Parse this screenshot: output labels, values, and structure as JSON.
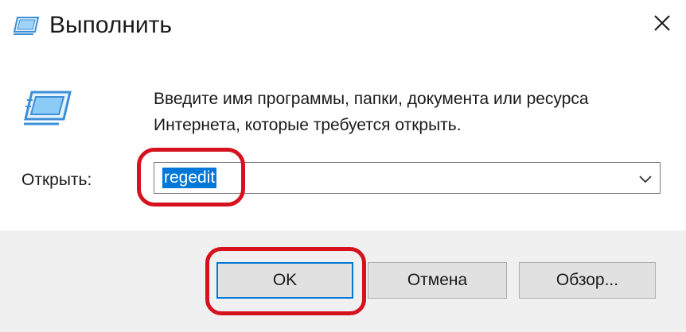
{
  "window": {
    "title": "Выполнить",
    "title_icon": "run-dialog-icon",
    "close_icon": "close-icon"
  },
  "body": {
    "icon": "run-dialog-icon",
    "description_line1": "Введите имя программы, папки, документа или ресурса",
    "description_line2": "Интернета, которые требуется открыть."
  },
  "open": {
    "label": "Открыть:",
    "value": "regedit",
    "dropdown_icon": "chevron-down-icon"
  },
  "buttons": {
    "ok": "OK",
    "cancel": "Отмена",
    "browse": "Обзор..."
  },
  "colors": {
    "selection": "#0078d7",
    "annotation": "#d6121e",
    "footer_bg": "#f0f0f0"
  }
}
